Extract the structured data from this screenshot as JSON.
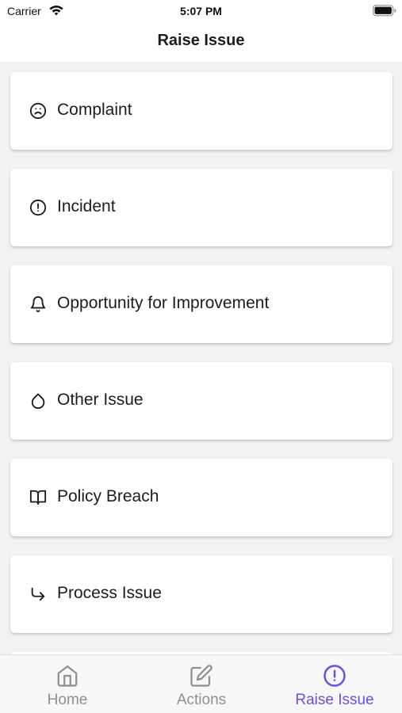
{
  "status_bar": {
    "carrier": "Carrier",
    "time": "5:07 PM",
    "wifi_icon": "wifi-icon",
    "battery_icon": "battery-icon"
  },
  "header": {
    "title": "Raise Issue"
  },
  "issue_types": [
    {
      "label": "Complaint",
      "icon": "frown-face-icon"
    },
    {
      "label": "Incident",
      "icon": "alert-circle-icon"
    },
    {
      "label": "Opportunity for Improvement",
      "icon": "bell-icon"
    },
    {
      "label": "Other Issue",
      "icon": "droplet-icon"
    },
    {
      "label": "Policy Breach",
      "icon": "open-book-icon"
    },
    {
      "label": "Process Issue",
      "icon": "corner-down-right-icon"
    }
  ],
  "tab_bar": {
    "tabs": [
      {
        "label": "Home",
        "icon": "home-icon",
        "active": false
      },
      {
        "label": "Actions",
        "icon": "edit-icon",
        "active": false
      },
      {
        "label": "Raise Issue",
        "icon": "alert-circle-icon",
        "active": true
      }
    ]
  },
  "colors": {
    "accent": "#6b4ee6",
    "inactive_tab": "#8e8e93",
    "background": "#f2f2f2",
    "card": "#ffffff"
  }
}
